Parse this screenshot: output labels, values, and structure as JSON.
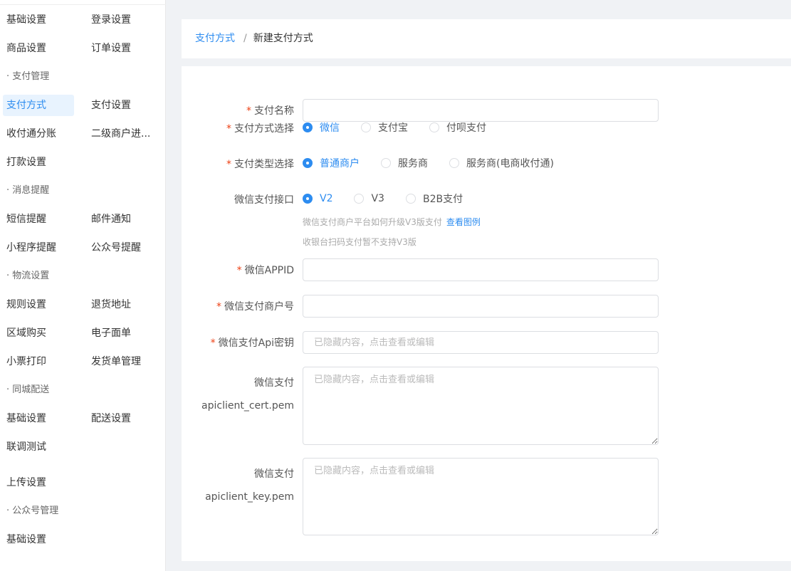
{
  "sidebar": {
    "rows": [
      {
        "left": "基础设置",
        "right": "登录设置"
      },
      {
        "left": "商品设置",
        "right": "订单设置"
      },
      {
        "group": "· 支付管理"
      },
      {
        "left": "支付方式",
        "right": "支付设置",
        "active": "left"
      },
      {
        "left": "收付通分账",
        "right": "二级商户进..."
      },
      {
        "left": "打款设置"
      },
      {
        "group": "· 消息提醒"
      },
      {
        "left": "短信提醒",
        "right": "邮件通知"
      },
      {
        "left": "小程序提醒",
        "right": "公众号提醒"
      },
      {
        "group": "· 物流设置"
      },
      {
        "left": "规则设置",
        "right": "退货地址"
      },
      {
        "left": "区域购买",
        "right": "电子面单"
      },
      {
        "left": "小票打印",
        "right": "发货单管理"
      },
      {
        "group": "· 同城配送"
      },
      {
        "left": "基础设置",
        "right": "配送设置"
      },
      {
        "left": "联调测试"
      },
      {
        "left": "上传设置"
      },
      {
        "group": "· 公众号管理"
      },
      {
        "left": "基础设置"
      }
    ]
  },
  "breadcrumb": {
    "link": "支付方式",
    "separator": "/",
    "current": "新建支付方式"
  },
  "form": {
    "pay_name": {
      "label": "支付名称",
      "required": true,
      "value": ""
    },
    "pay_method": {
      "label": "支付方式选择",
      "required": true,
      "options": [
        "微信",
        "支付宝",
        "付呗支付"
      ],
      "selected": 0
    },
    "pay_type": {
      "label": "支付类型选择",
      "required": true,
      "options": [
        "普通商户",
        "服务商",
        "服务商(电商收付通)"
      ],
      "selected": 0
    },
    "wx_api": {
      "label": "微信支付接口",
      "required": false,
      "options": [
        "V2",
        "V3",
        "B2B支付"
      ],
      "selected": 0
    },
    "hint1": "微信支付商户平台如何升级V3版支付",
    "hint1_link": "查看图例",
    "hint2": "收银台扫码支付暂不支持V3版",
    "appid": {
      "label": "微信APPID",
      "required": true,
      "value": ""
    },
    "mch_id": {
      "label": "微信支付商户号",
      "required": true,
      "value": ""
    },
    "api_key": {
      "label": "微信支付Api密钥",
      "required": true,
      "placeholder": "已隐藏内容，点击查看或编辑"
    },
    "cert": {
      "label_line1": "微信支付",
      "label_line2": "apiclient_cert.pem",
      "placeholder": "已隐藏内容，点击查看或编辑"
    },
    "key": {
      "label_line1": "微信支付",
      "label_line2": "apiclient_key.pem",
      "placeholder": "已隐藏内容，点击查看或编辑"
    }
  },
  "colors": {
    "accent": "#2d8cf0",
    "required": "#ed4014",
    "background": "#f0f2f5"
  }
}
